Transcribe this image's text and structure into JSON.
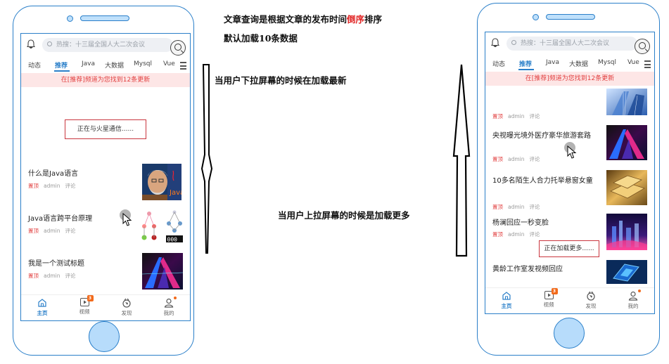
{
  "annotations": {
    "line1_a": "文章查询是根据文章的发布时间",
    "line1_red": "倒序",
    "line1_b": "排序",
    "line2": "默认加载10条数据",
    "pull_down": "当用户下拉屏幕的时候在加载最新",
    "pull_up": "当用户上拉屏幕的时候是加载更多"
  },
  "colors": {
    "frame": "#2a7fc9",
    "accent": "#2a7fc9",
    "notice_bg": "#fde6e6",
    "notice_text": "#e24040",
    "badge": "#f26a1b",
    "highlight": "#e02020"
  },
  "search": {
    "placeholder": "热搜：十三届全国人大二次会议"
  },
  "tabs": [
    "动态",
    "推荐",
    "Java",
    "大数据",
    "Mysql",
    "Vue"
  ],
  "active_tab": "推荐",
  "notice": "在[推荐]频道为您找到12条更新",
  "left_phone": {
    "status": "正在与火星通信......",
    "items": [
      {
        "title": "什么是Java语言",
        "tag": "置顶",
        "author": "admin",
        "comment": "评论",
        "thumb": "person-icon"
      },
      {
        "title": "Java语言跨平台原理",
        "tag": "置顶",
        "author": "admin",
        "comment": "评论",
        "thumb": "tree-diagram-icon"
      },
      {
        "title": "我是一个测试标题",
        "tag": "置顶",
        "author": "admin",
        "comment": "评论",
        "thumb": "abstract-image"
      }
    ]
  },
  "right_phone": {
    "status": "正在加载更多......",
    "items": [
      {
        "title": "",
        "tag": "置顶",
        "author": "admin",
        "comment": "评论",
        "thumb": "building-image"
      },
      {
        "title": "央视曝光境外医疗豪华旅游套路",
        "tag": "置顶",
        "author": "admin",
        "comment": "评论",
        "thumb": "abstract-image"
      },
      {
        "title": "10多名陌生人合力托举悬窗女童",
        "tag": "置顶",
        "author": "admin",
        "comment": "评论",
        "thumb": "gold-image"
      },
      {
        "title": "杨澜回应一秒变脸",
        "tag": "置顶",
        "author": "admin",
        "comment": "评论",
        "thumb": "city-night-image"
      },
      {
        "title": "黄龄工作室发视频回应",
        "tag": "",
        "author": "",
        "comment": "",
        "thumb": "tech-image"
      }
    ]
  },
  "bottom_nav": [
    {
      "label": "主页",
      "icon": "home-icon",
      "badge": ""
    },
    {
      "label": "视频",
      "icon": "video-icon",
      "badge": "3"
    },
    {
      "label": "发现",
      "icon": "discover-icon",
      "badge": ""
    },
    {
      "label": "我的",
      "icon": "user-icon",
      "badge": "dot"
    }
  ]
}
